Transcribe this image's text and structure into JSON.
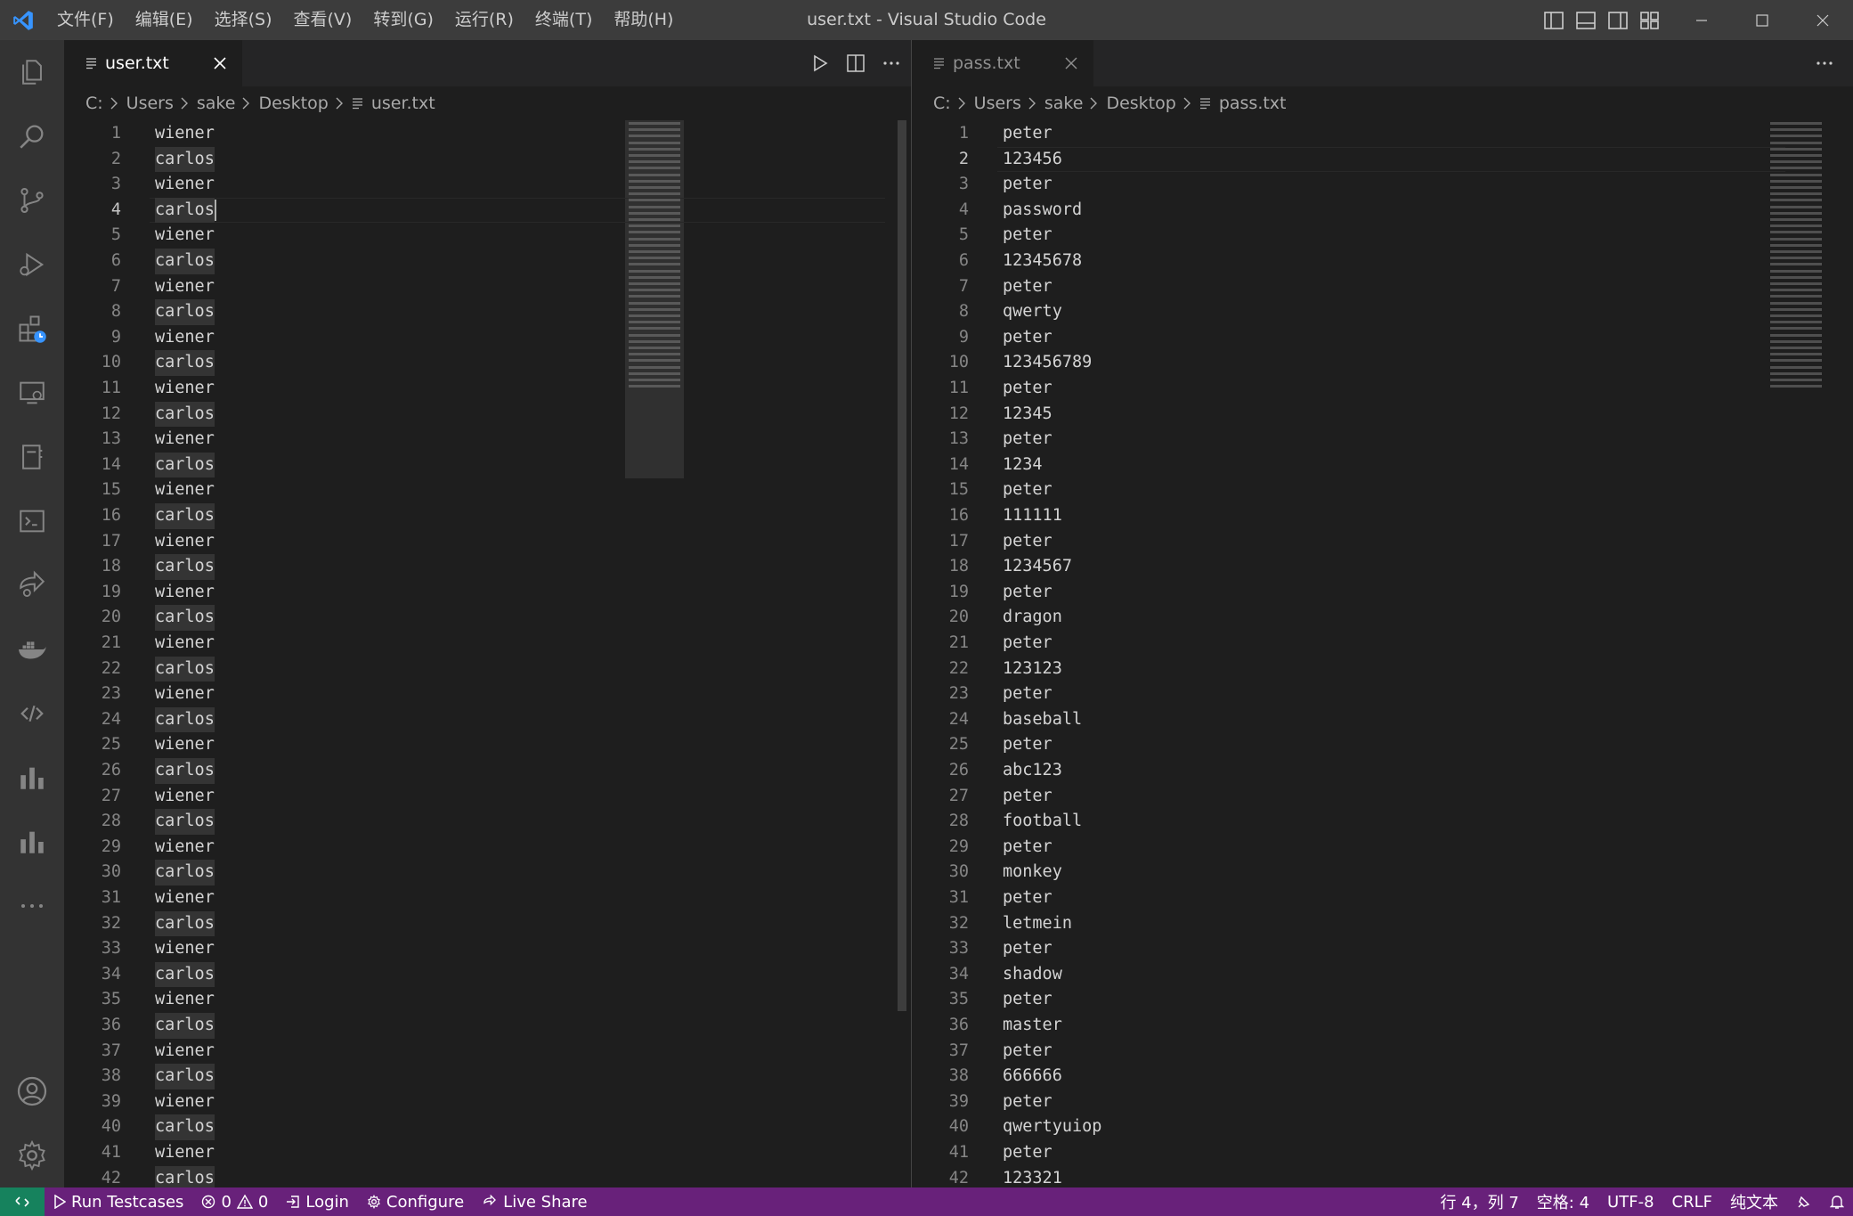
{
  "titlebar": {
    "menu": [
      "文件(F)",
      "编辑(E)",
      "选择(S)",
      "查看(V)",
      "转到(G)",
      "运行(R)",
      "终端(T)",
      "帮助(H)"
    ],
    "window_title": "user.txt - Visual Studio Code"
  },
  "left_editor": {
    "tab_label": "user.txt",
    "breadcrumb": [
      "C:",
      "Users",
      "sake",
      "Desktop",
      "user.txt"
    ],
    "current_line": 4,
    "lines": [
      "wiener",
      "carlos",
      "wiener",
      "carlos",
      "wiener",
      "carlos",
      "wiener",
      "carlos",
      "wiener",
      "carlos",
      "wiener",
      "carlos",
      "wiener",
      "carlos",
      "wiener",
      "carlos",
      "wiener",
      "carlos",
      "wiener",
      "carlos",
      "wiener",
      "carlos",
      "wiener",
      "carlos",
      "wiener",
      "carlos",
      "wiener",
      "carlos",
      "wiener",
      "carlos",
      "wiener",
      "carlos",
      "wiener",
      "carlos",
      "wiener",
      "carlos",
      "wiener",
      "carlos",
      "wiener",
      "carlos",
      "wiener",
      "carlos"
    ]
  },
  "right_editor": {
    "tab_label": "pass.txt",
    "breadcrumb": [
      "C:",
      "Users",
      "sake",
      "Desktop",
      "pass.txt"
    ],
    "current_line": 2,
    "lines": [
      "peter",
      "123456",
      "peter",
      "password",
      "peter",
      "12345678",
      "peter",
      "qwerty",
      "peter",
      "123456789",
      "peter",
      "12345",
      "peter",
      "1234",
      "peter",
      "111111",
      "peter",
      "1234567",
      "peter",
      "dragon",
      "peter",
      "123123",
      "peter",
      "baseball",
      "peter",
      "abc123",
      "peter",
      "football",
      "peter",
      "monkey",
      "peter",
      "letmein",
      "peter",
      "shadow",
      "peter",
      "master",
      "peter",
      "666666",
      "peter",
      "qwertyuiop",
      "peter",
      "123321"
    ]
  },
  "statusbar": {
    "run_testcases": "Run Testcases",
    "errors": "0",
    "warnings": "0",
    "login": "Login",
    "configure": "Configure",
    "live_share": "Live Share",
    "position": "行 4，列 7",
    "spaces": "空格: 4",
    "encoding": "UTF-8",
    "eol": "CRLF",
    "language": "纯文本"
  },
  "colors": {
    "statusbar_bg": "#68217a",
    "remote_bg": "#16825d",
    "accent_blue": "#3794ff"
  }
}
